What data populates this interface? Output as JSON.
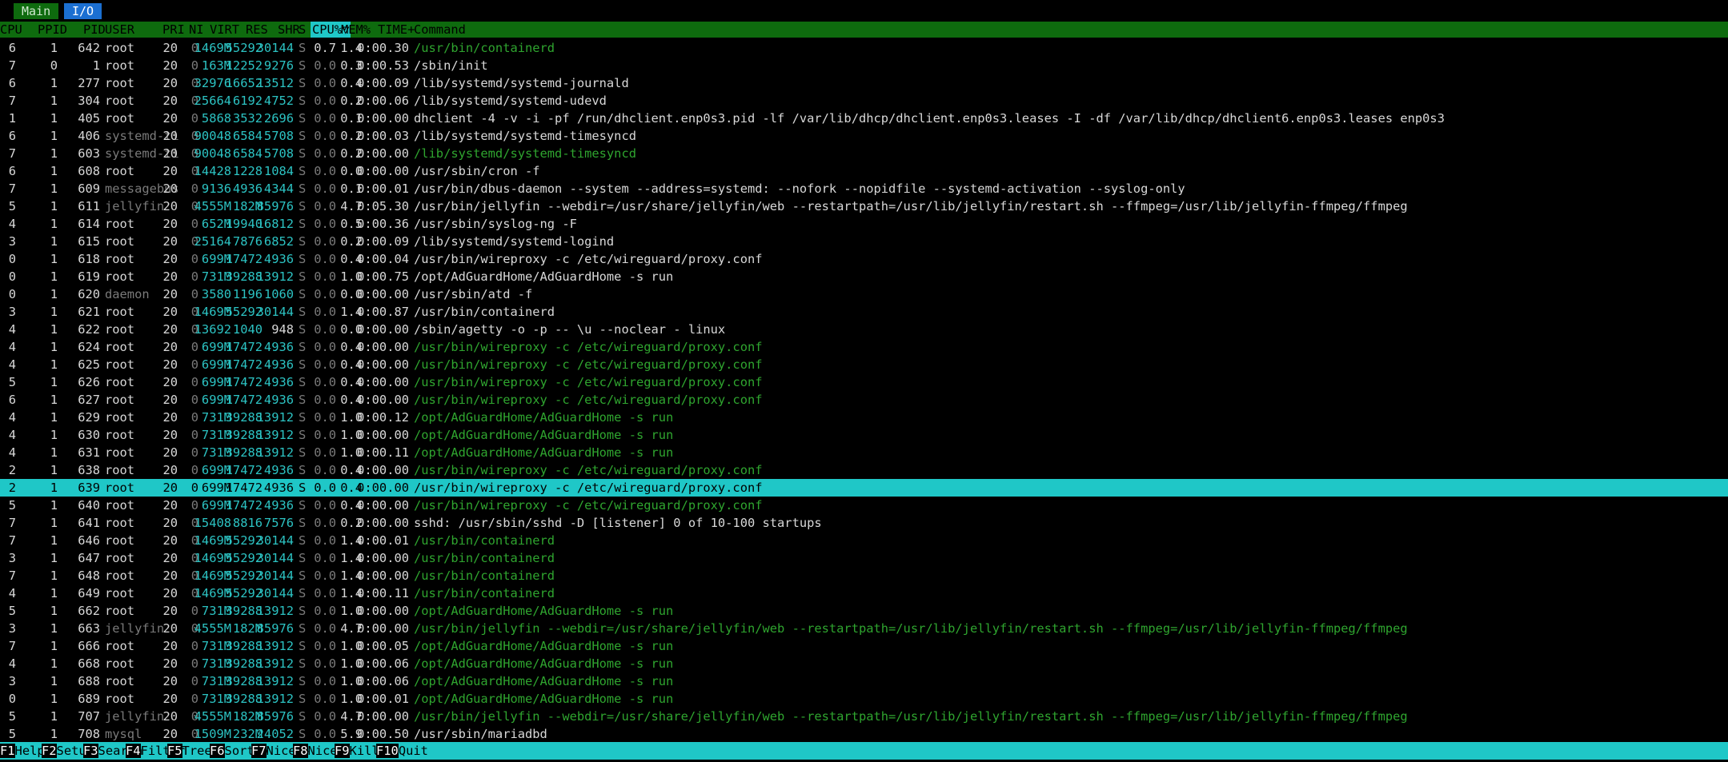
{
  "tabs": {
    "main": "Main",
    "io": "I/O"
  },
  "columns": [
    "CPU",
    "PPID",
    "PID",
    "USER",
    "PRI",
    "NI",
    "VIRT",
    "RES",
    "SHR",
    "S",
    "CPU%▽",
    "MEM%",
    "TIME+",
    "Command"
  ],
  "sort_column": "CPU%▽",
  "processes": [
    {
      "cpu": "6",
      "ppid": "1",
      "pid": "642",
      "user": "root",
      "pri": "20",
      "ni": "0",
      "virt": "1469M",
      "res": "55292",
      "shr": "30144",
      "s": "S",
      "cpupct": "0.7",
      "mem": "1.4",
      "time": "0:00.30",
      "cmd": "/usr/bin/containerd",
      "thread": true
    },
    {
      "cpu": "7",
      "ppid": "0",
      "pid": "1",
      "user": "root",
      "pri": "20",
      "ni": "0",
      "virt": "163M",
      "res": "12252",
      "shr": "9276",
      "s": "S",
      "cpupct": "0.0",
      "mem": "0.3",
      "time": "0:00.53",
      "cmd": "/sbin/init",
      "thread": false
    },
    {
      "cpu": "6",
      "ppid": "1",
      "pid": "277",
      "user": "root",
      "pri": "20",
      "ni": "0",
      "virt": "32976",
      "res": "16652",
      "shr": "13512",
      "s": "S",
      "cpupct": "0.0",
      "mem": "0.4",
      "time": "0:00.09",
      "cmd": "/lib/systemd/systemd-journald",
      "thread": false
    },
    {
      "cpu": "7",
      "ppid": "1",
      "pid": "304",
      "user": "root",
      "pri": "20",
      "ni": "0",
      "virt": "25664",
      "res": "6192",
      "shr": "4752",
      "s": "S",
      "cpupct": "0.0",
      "mem": "0.2",
      "time": "0:00.06",
      "cmd": "/lib/systemd/systemd-udevd",
      "thread": false
    },
    {
      "cpu": "1",
      "ppid": "1",
      "pid": "405",
      "user": "root",
      "pri": "20",
      "ni": "0",
      "virt": "5868",
      "res": "3532",
      "shr": "2696",
      "s": "S",
      "cpupct": "0.0",
      "mem": "0.1",
      "time": "0:00.00",
      "cmd": "dhclient -4 -v -i -pf /run/dhclient.enp0s3.pid -lf /var/lib/dhcp/dhclient.enp0s3.leases -I -df /var/lib/dhcp/dhclient6.enp0s3.leases enp0s3",
      "thread": false
    },
    {
      "cpu": "6",
      "ppid": "1",
      "pid": "406",
      "user": "systemd-ti",
      "pri": "20",
      "ni": "0",
      "virt": "90048",
      "res": "6584",
      "shr": "5708",
      "s": "S",
      "cpupct": "0.0",
      "mem": "0.2",
      "time": "0:00.03",
      "cmd": "/lib/systemd/systemd-timesyncd",
      "thread": false
    },
    {
      "cpu": "7",
      "ppid": "1",
      "pid": "603",
      "user": "systemd-ti",
      "pri": "20",
      "ni": "0",
      "virt": "90048",
      "res": "6584",
      "shr": "5708",
      "s": "S",
      "cpupct": "0.0",
      "mem": "0.2",
      "time": "0:00.00",
      "cmd": "/lib/systemd/systemd-timesyncd",
      "thread": true
    },
    {
      "cpu": "6",
      "ppid": "1",
      "pid": "608",
      "user": "root",
      "pri": "20",
      "ni": "0",
      "virt": "14428",
      "res": "1228",
      "shr": "1084",
      "s": "S",
      "cpupct": "0.0",
      "mem": "0.0",
      "time": "0:00.00",
      "cmd": "/usr/sbin/cron -f",
      "thread": false
    },
    {
      "cpu": "7",
      "ppid": "1",
      "pid": "609",
      "user": "messagebus",
      "pri": "20",
      "ni": "0",
      "virt": "9136",
      "res": "4936",
      "shr": "4344",
      "s": "S",
      "cpupct": "0.0",
      "mem": "0.1",
      "time": "0:00.01",
      "cmd": "/usr/bin/dbus-daemon --system --address=systemd: --nofork --nopidfile --systemd-activation --syslog-only",
      "thread": false
    },
    {
      "cpu": "5",
      "ppid": "1",
      "pid": "611",
      "user": "jellyfin",
      "pri": "20",
      "ni": "0",
      "virt": "4555M",
      "res": "182M",
      "shr": "85976",
      "s": "S",
      "cpupct": "0.0",
      "mem": "4.7",
      "time": "0:05.30",
      "cmd": "/usr/bin/jellyfin --webdir=/usr/share/jellyfin/web --restartpath=/usr/lib/jellyfin/restart.sh --ffmpeg=/usr/lib/jellyfin-ffmpeg/ffmpeg",
      "thread": false
    },
    {
      "cpu": "4",
      "ppid": "1",
      "pid": "614",
      "user": "root",
      "pri": "20",
      "ni": "0",
      "virt": "652M",
      "res": "19940",
      "shr": "16812",
      "s": "S",
      "cpupct": "0.0",
      "mem": "0.5",
      "time": "0:00.36",
      "cmd": "/usr/sbin/syslog-ng -F",
      "thread": false
    },
    {
      "cpu": "3",
      "ppid": "1",
      "pid": "615",
      "user": "root",
      "pri": "20",
      "ni": "0",
      "virt": "25164",
      "res": "7876",
      "shr": "6852",
      "s": "S",
      "cpupct": "0.0",
      "mem": "0.2",
      "time": "0:00.09",
      "cmd": "/lib/systemd/systemd-logind",
      "thread": false
    },
    {
      "cpu": "0",
      "ppid": "1",
      "pid": "618",
      "user": "root",
      "pri": "20",
      "ni": "0",
      "virt": "699M",
      "res": "17472",
      "shr": "4936",
      "s": "S",
      "cpupct": "0.0",
      "mem": "0.4",
      "time": "0:00.04",
      "cmd": "/usr/bin/wireproxy -c /etc/wireguard/proxy.conf",
      "thread": false
    },
    {
      "cpu": "0",
      "ppid": "1",
      "pid": "619",
      "user": "root",
      "pri": "20",
      "ni": "0",
      "virt": "731M",
      "res": "39288",
      "shr": "13912",
      "s": "S",
      "cpupct": "0.0",
      "mem": "1.0",
      "time": "0:00.75",
      "cmd": "/opt/AdGuardHome/AdGuardHome -s run",
      "thread": false
    },
    {
      "cpu": "0",
      "ppid": "1",
      "pid": "620",
      "user": "daemon",
      "pri": "20",
      "ni": "0",
      "virt": "3580",
      "res": "1196",
      "shr": "1060",
      "s": "S",
      "cpupct": "0.0",
      "mem": "0.0",
      "time": "0:00.00",
      "cmd": "/usr/sbin/atd -f",
      "thread": false
    },
    {
      "cpu": "3",
      "ppid": "1",
      "pid": "621",
      "user": "root",
      "pri": "20",
      "ni": "0",
      "virt": "1469M",
      "res": "55292",
      "shr": "30144",
      "s": "S",
      "cpupct": "0.0",
      "mem": "1.4",
      "time": "0:00.87",
      "cmd": "/usr/bin/containerd",
      "thread": false
    },
    {
      "cpu": "4",
      "ppid": "1",
      "pid": "622",
      "user": "root",
      "pri": "20",
      "ni": "0",
      "virt": "13692",
      "res": "1040",
      "shr": "948",
      "s": "S",
      "cpupct": "0.0",
      "mem": "0.0",
      "time": "0:00.00",
      "cmd": "/sbin/agetty -o -p -- \\u --noclear - linux",
      "thread": false
    },
    {
      "cpu": "4",
      "ppid": "1",
      "pid": "624",
      "user": "root",
      "pri": "20",
      "ni": "0",
      "virt": "699M",
      "res": "17472",
      "shr": "4936",
      "s": "S",
      "cpupct": "0.0",
      "mem": "0.4",
      "time": "0:00.00",
      "cmd": "/usr/bin/wireproxy -c /etc/wireguard/proxy.conf",
      "thread": true
    },
    {
      "cpu": "4",
      "ppid": "1",
      "pid": "625",
      "user": "root",
      "pri": "20",
      "ni": "0",
      "virt": "699M",
      "res": "17472",
      "shr": "4936",
      "s": "S",
      "cpupct": "0.0",
      "mem": "0.4",
      "time": "0:00.00",
      "cmd": "/usr/bin/wireproxy -c /etc/wireguard/proxy.conf",
      "thread": true
    },
    {
      "cpu": "5",
      "ppid": "1",
      "pid": "626",
      "user": "root",
      "pri": "20",
      "ni": "0",
      "virt": "699M",
      "res": "17472",
      "shr": "4936",
      "s": "S",
      "cpupct": "0.0",
      "mem": "0.4",
      "time": "0:00.00",
      "cmd": "/usr/bin/wireproxy -c /etc/wireguard/proxy.conf",
      "thread": true
    },
    {
      "cpu": "6",
      "ppid": "1",
      "pid": "627",
      "user": "root",
      "pri": "20",
      "ni": "0",
      "virt": "699M",
      "res": "17472",
      "shr": "4936",
      "s": "S",
      "cpupct": "0.0",
      "mem": "0.4",
      "time": "0:00.00",
      "cmd": "/usr/bin/wireproxy -c /etc/wireguard/proxy.conf",
      "thread": true
    },
    {
      "cpu": "4",
      "ppid": "1",
      "pid": "629",
      "user": "root",
      "pri": "20",
      "ni": "0",
      "virt": "731M",
      "res": "39288",
      "shr": "13912",
      "s": "S",
      "cpupct": "0.0",
      "mem": "1.0",
      "time": "0:00.12",
      "cmd": "/opt/AdGuardHome/AdGuardHome -s run",
      "thread": true
    },
    {
      "cpu": "4",
      "ppid": "1",
      "pid": "630",
      "user": "root",
      "pri": "20",
      "ni": "0",
      "virt": "731M",
      "res": "39288",
      "shr": "13912",
      "s": "S",
      "cpupct": "0.0",
      "mem": "1.0",
      "time": "0:00.00",
      "cmd": "/opt/AdGuardHome/AdGuardHome -s run",
      "thread": true
    },
    {
      "cpu": "4",
      "ppid": "1",
      "pid": "631",
      "user": "root",
      "pri": "20",
      "ni": "0",
      "virt": "731M",
      "res": "39288",
      "shr": "13912",
      "s": "S",
      "cpupct": "0.0",
      "mem": "1.0",
      "time": "0:00.11",
      "cmd": "/opt/AdGuardHome/AdGuardHome -s run",
      "thread": true
    },
    {
      "cpu": "2",
      "ppid": "1",
      "pid": "638",
      "user": "root",
      "pri": "20",
      "ni": "0",
      "virt": "699M",
      "res": "17472",
      "shr": "4936",
      "s": "S",
      "cpupct": "0.0",
      "mem": "0.4",
      "time": "0:00.00",
      "cmd": "/usr/bin/wireproxy -c /etc/wireguard/proxy.conf",
      "thread": true
    },
    {
      "cpu": "2",
      "ppid": "1",
      "pid": "639",
      "user": "root",
      "pri": "20",
      "ni": "0",
      "virt": "699M",
      "res": "17472",
      "shr": "4936",
      "s": "S",
      "cpupct": "0.0",
      "mem": "0.4",
      "time": "0:00.00",
      "cmd": "/usr/bin/wireproxy -c /etc/wireguard/proxy.conf",
      "thread": true,
      "selected": true
    },
    {
      "cpu": "5",
      "ppid": "1",
      "pid": "640",
      "user": "root",
      "pri": "20",
      "ni": "0",
      "virt": "699M",
      "res": "17472",
      "shr": "4936",
      "s": "S",
      "cpupct": "0.0",
      "mem": "0.4",
      "time": "0:00.00",
      "cmd": "/usr/bin/wireproxy -c /etc/wireguard/proxy.conf",
      "thread": true
    },
    {
      "cpu": "7",
      "ppid": "1",
      "pid": "641",
      "user": "root",
      "pri": "20",
      "ni": "0",
      "virt": "15408",
      "res": "8816",
      "shr": "7576",
      "s": "S",
      "cpupct": "0.0",
      "mem": "0.2",
      "time": "0:00.00",
      "cmd": "sshd: /usr/sbin/sshd -D [listener] 0 of 10-100 startups",
      "thread": false
    },
    {
      "cpu": "7",
      "ppid": "1",
      "pid": "646",
      "user": "root",
      "pri": "20",
      "ni": "0",
      "virt": "1469M",
      "res": "55292",
      "shr": "30144",
      "s": "S",
      "cpupct": "0.0",
      "mem": "1.4",
      "time": "0:00.01",
      "cmd": "/usr/bin/containerd",
      "thread": true
    },
    {
      "cpu": "3",
      "ppid": "1",
      "pid": "647",
      "user": "root",
      "pri": "20",
      "ni": "0",
      "virt": "1469M",
      "res": "55292",
      "shr": "30144",
      "s": "S",
      "cpupct": "0.0",
      "mem": "1.4",
      "time": "0:00.00",
      "cmd": "/usr/bin/containerd",
      "thread": true
    },
    {
      "cpu": "7",
      "ppid": "1",
      "pid": "648",
      "user": "root",
      "pri": "20",
      "ni": "0",
      "virt": "1469M",
      "res": "55292",
      "shr": "30144",
      "s": "S",
      "cpupct": "0.0",
      "mem": "1.4",
      "time": "0:00.00",
      "cmd": "/usr/bin/containerd",
      "thread": true
    },
    {
      "cpu": "4",
      "ppid": "1",
      "pid": "649",
      "user": "root",
      "pri": "20",
      "ni": "0",
      "virt": "1469M",
      "res": "55292",
      "shr": "30144",
      "s": "S",
      "cpupct": "0.0",
      "mem": "1.4",
      "time": "0:00.11",
      "cmd": "/usr/bin/containerd",
      "thread": true
    },
    {
      "cpu": "5",
      "ppid": "1",
      "pid": "662",
      "user": "root",
      "pri": "20",
      "ni": "0",
      "virt": "731M",
      "res": "39288",
      "shr": "13912",
      "s": "S",
      "cpupct": "0.0",
      "mem": "1.0",
      "time": "0:00.00",
      "cmd": "/opt/AdGuardHome/AdGuardHome -s run",
      "thread": true
    },
    {
      "cpu": "3",
      "ppid": "1",
      "pid": "663",
      "user": "jellyfin",
      "pri": "20",
      "ni": "0",
      "virt": "4555M",
      "res": "182M",
      "shr": "85976",
      "s": "S",
      "cpupct": "0.0",
      "mem": "4.7",
      "time": "0:00.00",
      "cmd": "/usr/bin/jellyfin --webdir=/usr/share/jellyfin/web --restartpath=/usr/lib/jellyfin/restart.sh --ffmpeg=/usr/lib/jellyfin-ffmpeg/ffmpeg",
      "thread": true
    },
    {
      "cpu": "7",
      "ppid": "1",
      "pid": "666",
      "user": "root",
      "pri": "20",
      "ni": "0",
      "virt": "731M",
      "res": "39288",
      "shr": "13912",
      "s": "S",
      "cpupct": "0.0",
      "mem": "1.0",
      "time": "0:00.05",
      "cmd": "/opt/AdGuardHome/AdGuardHome -s run",
      "thread": true
    },
    {
      "cpu": "4",
      "ppid": "1",
      "pid": "668",
      "user": "root",
      "pri": "20",
      "ni": "0",
      "virt": "731M",
      "res": "39288",
      "shr": "13912",
      "s": "S",
      "cpupct": "0.0",
      "mem": "1.0",
      "time": "0:00.06",
      "cmd": "/opt/AdGuardHome/AdGuardHome -s run",
      "thread": true
    },
    {
      "cpu": "3",
      "ppid": "1",
      "pid": "688",
      "user": "root",
      "pri": "20",
      "ni": "0",
      "virt": "731M",
      "res": "39288",
      "shr": "13912",
      "s": "S",
      "cpupct": "0.0",
      "mem": "1.0",
      "time": "0:00.06",
      "cmd": "/opt/AdGuardHome/AdGuardHome -s run",
      "thread": true
    },
    {
      "cpu": "0",
      "ppid": "1",
      "pid": "689",
      "user": "root",
      "pri": "20",
      "ni": "0",
      "virt": "731M",
      "res": "39288",
      "shr": "13912",
      "s": "S",
      "cpupct": "0.0",
      "mem": "1.0",
      "time": "0:00.01",
      "cmd": "/opt/AdGuardHome/AdGuardHome -s run",
      "thread": true
    },
    {
      "cpu": "5",
      "ppid": "1",
      "pid": "707",
      "user": "jellyfin",
      "pri": "20",
      "ni": "0",
      "virt": "4555M",
      "res": "182M",
      "shr": "85976",
      "s": "S",
      "cpupct": "0.0",
      "mem": "4.7",
      "time": "0:00.00",
      "cmd": "/usr/bin/jellyfin --webdir=/usr/share/jellyfin/web --restartpath=/usr/lib/jellyfin/restart.sh --ffmpeg=/usr/lib/jellyfin-ffmpeg/ffmpeg",
      "thread": true
    },
    {
      "cpu": "5",
      "ppid": "1",
      "pid": "708",
      "user": "mysql",
      "pri": "20",
      "ni": "0",
      "virt": "1509M",
      "res": "232M",
      "shr": "24052",
      "s": "S",
      "cpupct": "0.0",
      "mem": "5.9",
      "time": "0:00.50",
      "cmd": "/usr/sbin/mariadbd",
      "thread": false
    }
  ],
  "footer": [
    {
      "key": "F1",
      "label": "Help"
    },
    {
      "key": "F2",
      "label": "Setup"
    },
    {
      "key": "F3",
      "label": "Search"
    },
    {
      "key": "F4",
      "label": "Filter"
    },
    {
      "key": "F5",
      "label": "Tree"
    },
    {
      "key": "F6",
      "label": "SortBy"
    },
    {
      "key": "F7",
      "label": "Nice -"
    },
    {
      "key": "F8",
      "label": "Nice +"
    },
    {
      "key": "F9",
      "label": "Kill"
    },
    {
      "key": "F10",
      "label": "Quit"
    }
  ],
  "colors": {
    "header_bg": "#0e6b0e",
    "selected_bg": "#1fc7c7",
    "thread_cmd": "#2fa52f",
    "dim_user": "#7a7a7a"
  }
}
